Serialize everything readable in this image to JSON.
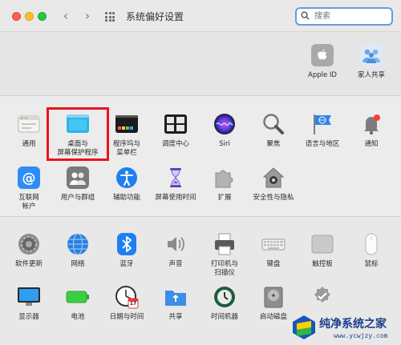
{
  "window": {
    "title": "系统偏好设置"
  },
  "search": {
    "placeholder": "搜索"
  },
  "account": [
    {
      "label": "Apple ID"
    },
    {
      "label": "家人共享"
    }
  ],
  "row1": [
    {
      "label": "通用"
    },
    {
      "label": "桌面与\n屏幕保护程序"
    },
    {
      "label": "程序坞与\n菜单栏"
    },
    {
      "label": "调度中心"
    },
    {
      "label": "Siri"
    },
    {
      "label": "聚焦"
    },
    {
      "label": "语言与地区"
    },
    {
      "label": "通知"
    }
  ],
  "row2": [
    {
      "label": "互联网\n帐户"
    },
    {
      "label": "用户与群组"
    },
    {
      "label": "辅助功能"
    },
    {
      "label": "屏幕使用时间"
    },
    {
      "label": "扩展"
    },
    {
      "label": "安全性与隐私"
    }
  ],
  "row3": [
    {
      "label": "软件更新"
    },
    {
      "label": "网络"
    },
    {
      "label": "蓝牙"
    },
    {
      "label": "声音"
    },
    {
      "label": "打印机与\n扫描仪"
    },
    {
      "label": "键盘"
    },
    {
      "label": "触控板"
    },
    {
      "label": "鼠标"
    }
  ],
  "row4": [
    {
      "label": "显示器"
    },
    {
      "label": "电池"
    },
    {
      "label": "日期与时间"
    },
    {
      "label": "共享"
    },
    {
      "label": "时间机器"
    },
    {
      "label": "启动磁盘"
    }
  ],
  "date_icon": {
    "day": "17"
  },
  "watermark": {
    "text": "纯净系统之家",
    "url": "www.ycwjzy.com"
  }
}
